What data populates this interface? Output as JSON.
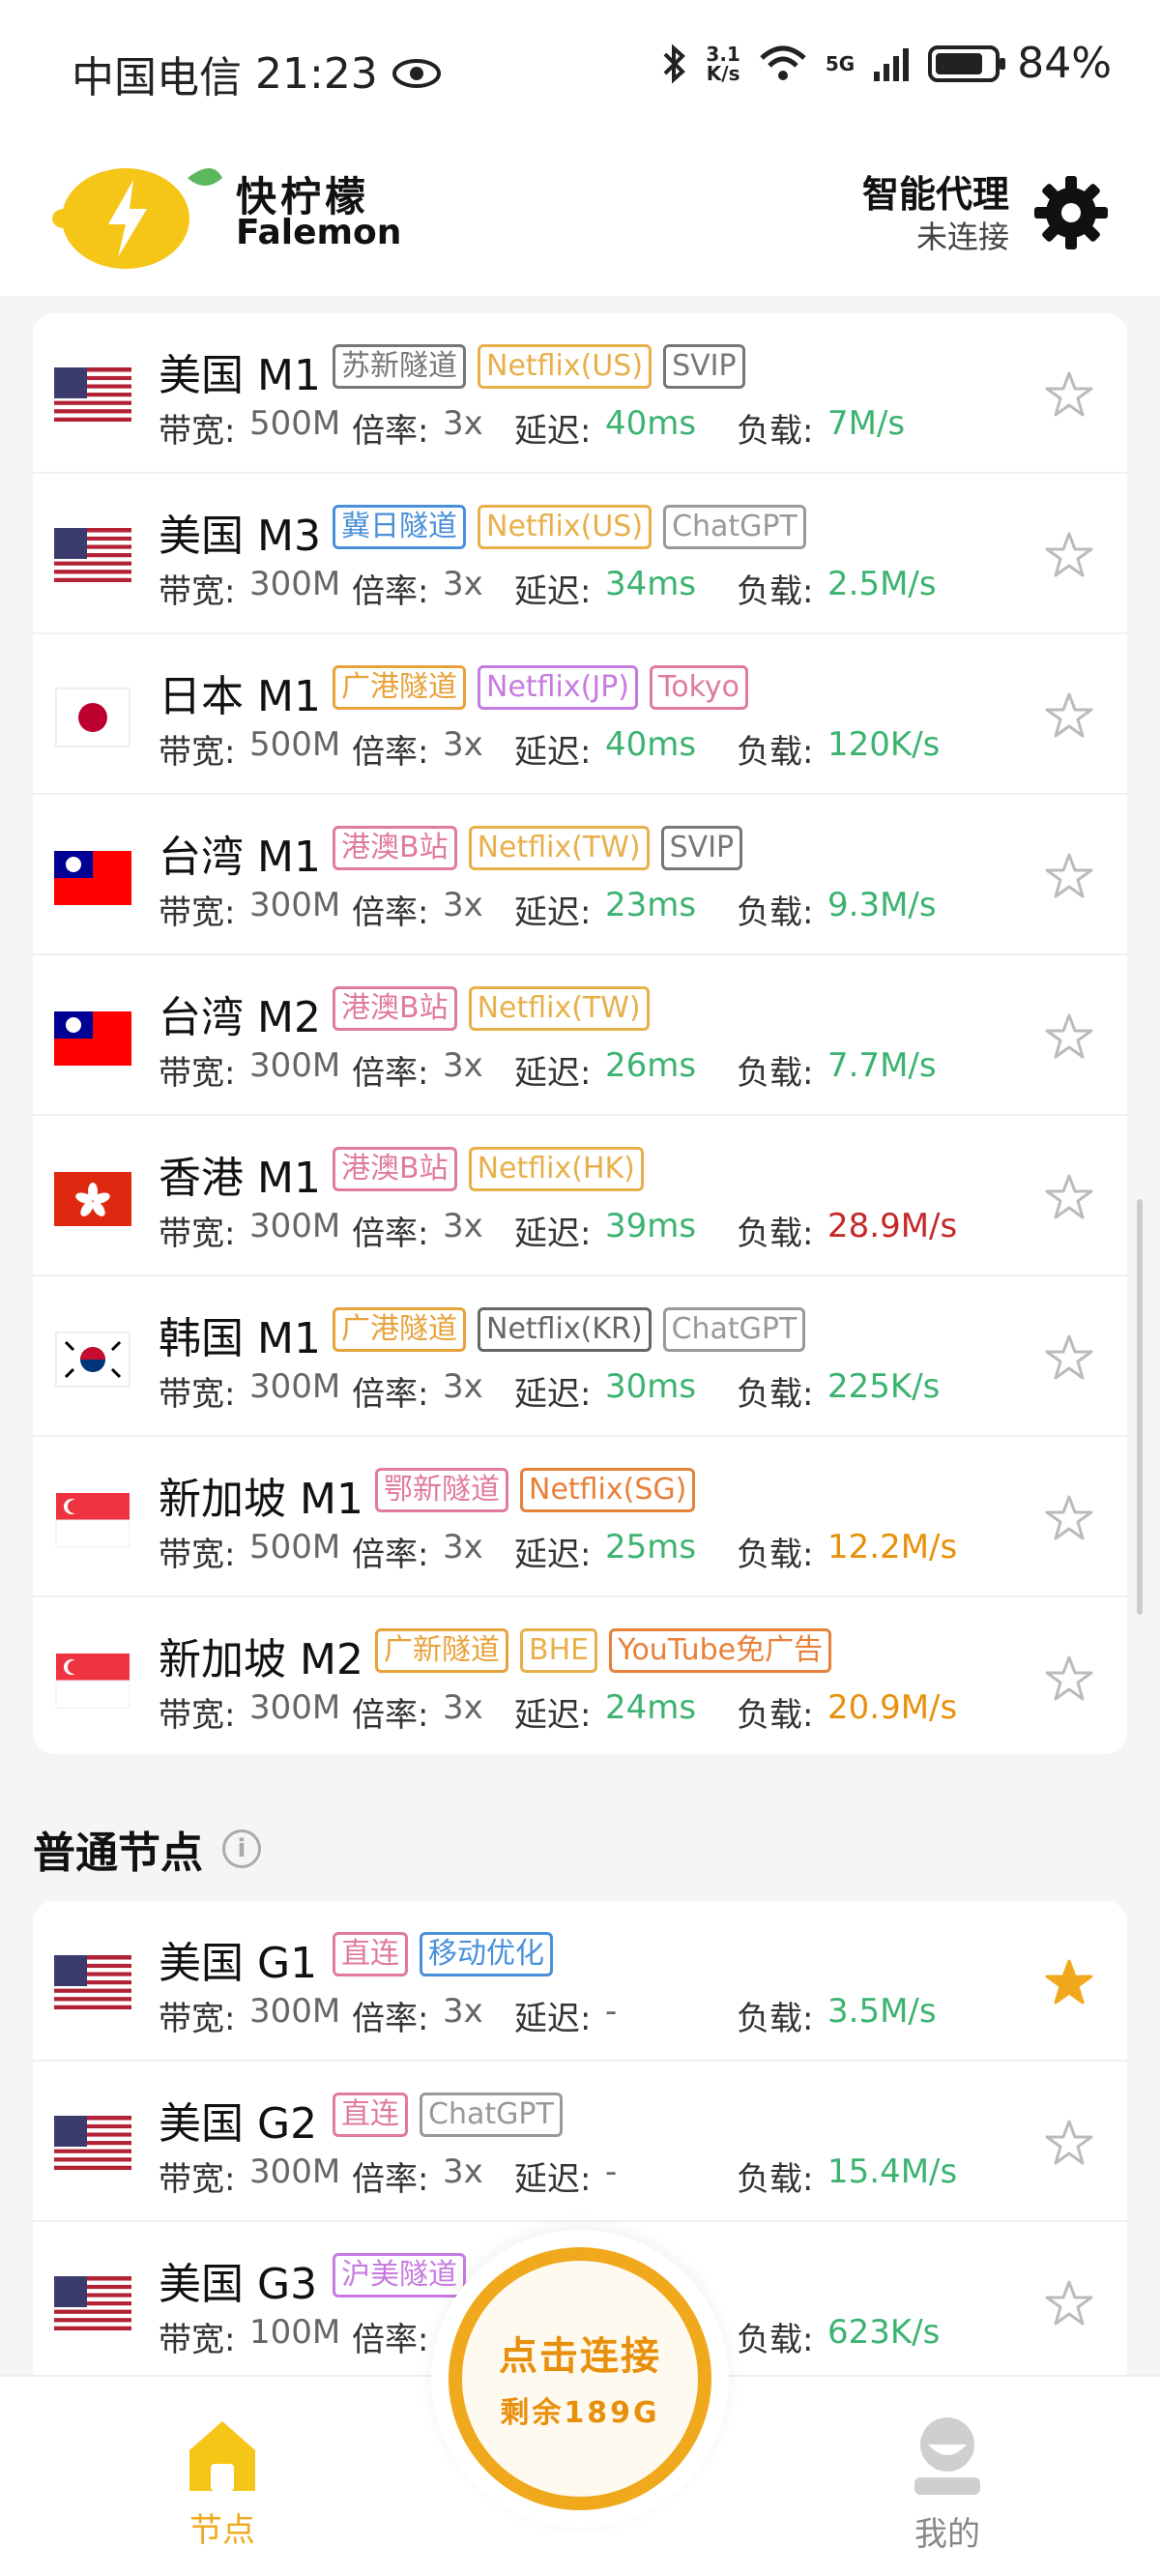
{
  "status_bar": {
    "carrier": "中国电信",
    "time": "21:23",
    "net_speed_value": "3.1",
    "net_speed_unit": "K/s",
    "network": "5G",
    "battery": "84%"
  },
  "header": {
    "logo_cn": "快柠檬",
    "logo_en": "Falemon",
    "proxy_title": "智能代理",
    "proxy_status": "未连接"
  },
  "labels": {
    "bandwidth": "带宽:",
    "multiplier": "倍率:",
    "latency": "延迟:",
    "load": "负载:"
  },
  "premium_nodes": [
    {
      "flag": "us",
      "name": "美国 M1",
      "tags": [
        {
          "text": "苏新隧道",
          "color": "#777777"
        },
        {
          "text": "Netflix(US)",
          "color": "#e8b04a"
        },
        {
          "text": "SVIP",
          "color": "#777777"
        }
      ],
      "bandwidth": "500M",
      "multiplier": "3x",
      "latency": "40ms",
      "load": "7M/s",
      "load_color": "green",
      "starred": false
    },
    {
      "flag": "us",
      "name": "美国 M3",
      "tags": [
        {
          "text": "冀日隧道",
          "color": "#4a90d9"
        },
        {
          "text": "Netflix(US)",
          "color": "#e8b04a"
        },
        {
          "text": "ChatGPT",
          "color": "#999999"
        }
      ],
      "bandwidth": "300M",
      "multiplier": "3x",
      "latency": "34ms",
      "load": "2.5M/s",
      "load_color": "green",
      "starred": false
    },
    {
      "flag": "jp",
      "name": "日本 M1",
      "tags": [
        {
          "text": "广港隧道",
          "color": "#e8a23a"
        },
        {
          "text": "Netflix(JP)",
          "color": "#c67be0"
        },
        {
          "text": "Tokyo",
          "color": "#e07b9a"
        }
      ],
      "bandwidth": "500M",
      "multiplier": "3x",
      "latency": "40ms",
      "load": "120K/s",
      "load_color": "green",
      "starred": false
    },
    {
      "flag": "tw",
      "name": "台湾 M1",
      "tags": [
        {
          "text": "港澳B站",
          "color": "#e07b9a"
        },
        {
          "text": "Netflix(TW)",
          "color": "#e8b04a"
        },
        {
          "text": "SVIP",
          "color": "#777777"
        }
      ],
      "bandwidth": "300M",
      "multiplier": "3x",
      "latency": "23ms",
      "load": "9.3M/s",
      "load_color": "green",
      "starred": false
    },
    {
      "flag": "tw",
      "name": "台湾 M2",
      "tags": [
        {
          "text": "港澳B站",
          "color": "#e07b9a"
        },
        {
          "text": "Netflix(TW)",
          "color": "#e8b04a"
        }
      ],
      "bandwidth": "300M",
      "multiplier": "3x",
      "latency": "26ms",
      "load": "7.7M/s",
      "load_color": "green",
      "starred": false
    },
    {
      "flag": "hk",
      "name": "香港 M1",
      "tags": [
        {
          "text": "港澳B站",
          "color": "#e07b9a"
        },
        {
          "text": "Netflix(HK)",
          "color": "#e8b04a"
        }
      ],
      "bandwidth": "300M",
      "multiplier": "3x",
      "latency": "39ms",
      "load": "28.9M/s",
      "load_color": "red",
      "starred": false
    },
    {
      "flag": "kr",
      "name": "韩国 M1",
      "tags": [
        {
          "text": "广港隧道",
          "color": "#e8a23a"
        },
        {
          "text": "Netflix(KR)",
          "color": "#666666"
        },
        {
          "text": "ChatGPT",
          "color": "#999999"
        }
      ],
      "bandwidth": "300M",
      "multiplier": "3x",
      "latency": "30ms",
      "load": "225K/s",
      "load_color": "green",
      "starred": false
    },
    {
      "flag": "sg",
      "name": "新加坡 M1",
      "tags": [
        {
          "text": "鄂新隧道",
          "color": "#e07b9a"
        },
        {
          "text": "Netflix(SG)",
          "color": "#e8803a"
        }
      ],
      "bandwidth": "500M",
      "multiplier": "3x",
      "latency": "25ms",
      "load": "12.2M/s",
      "load_color": "orange",
      "starred": false
    },
    {
      "flag": "sg",
      "name": "新加坡 M2",
      "tags": [
        {
          "text": "广新隧道",
          "color": "#e8a23a"
        },
        {
          "text": "BHE",
          "color": "#e8b04a"
        },
        {
          "text": "YouTube免广告",
          "color": "#e8803a"
        }
      ],
      "bandwidth": "300M",
      "multiplier": "3x",
      "latency": "24ms",
      "load": "20.9M/s",
      "load_color": "orange",
      "starred": false
    }
  ],
  "normal_section": {
    "title": "普通节点",
    "info_icon": "i"
  },
  "normal_nodes": [
    {
      "flag": "us",
      "name": "美国 G1",
      "tags": [
        {
          "text": "直连",
          "color": "#e07b9a"
        },
        {
          "text": "移动优化",
          "color": "#4a90d9"
        }
      ],
      "bandwidth": "300M",
      "multiplier": "3x",
      "latency": "-",
      "load": "3.5M/s",
      "load_color": "green",
      "starred": true
    },
    {
      "flag": "us",
      "name": "美国 G2",
      "tags": [
        {
          "text": "直连",
          "color": "#e07b9a"
        },
        {
          "text": "ChatGPT",
          "color": "#999999"
        }
      ],
      "bandwidth": "300M",
      "multiplier": "3x",
      "latency": "-",
      "load": "15.4M/s",
      "load_color": "green",
      "starred": false
    },
    {
      "flag": "us",
      "name": "美国 G3",
      "tags": [
        {
          "text": "沪美隧道",
          "color": "#c67be0"
        }
      ],
      "bandwidth": "100M",
      "multiplier": "",
      "latency": "",
      "load": "623K/s",
      "load_color": "green",
      "starred": false
    }
  ],
  "connect_button": {
    "main": "点击连接",
    "sub": "剩余189G"
  },
  "bottom_nav": {
    "nodes_label": "节点",
    "mine_label": "我的"
  },
  "colors": {
    "accent": "#f0a91c",
    "green": "#3cb371",
    "red": "#c62828",
    "orange": "#e8900c"
  }
}
